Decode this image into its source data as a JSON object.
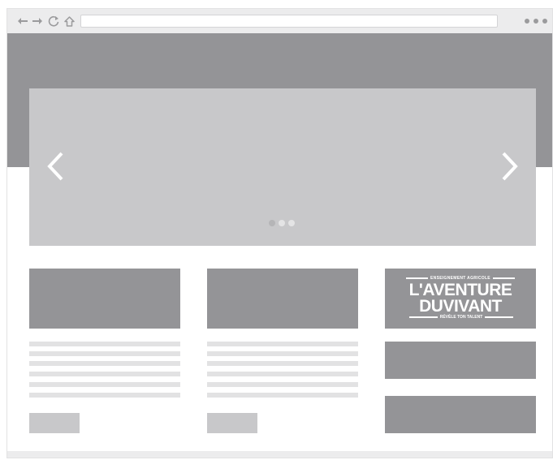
{
  "browser": {
    "toolbar_icons": [
      "back-arrow-icon",
      "forward-arrow-icon",
      "reload-icon",
      "home-icon",
      "menu-dots-icon"
    ],
    "address_value": ""
  },
  "slider": {
    "slide_count": 3,
    "active_slide": 2
  },
  "logo": {
    "line1": "ENSEIGNEMENT AGRICOLE",
    "line2": "L'AVENTURE",
    "line3": "DUVIVANT",
    "line4": "RÉVÈLE TON TALENT"
  },
  "colors": {
    "dark_gray": "#949497",
    "mid_gray": "#c8c8ca",
    "light_gray": "#e2e2e3",
    "toolbar": "#ececed",
    "white": "#ffffff"
  }
}
